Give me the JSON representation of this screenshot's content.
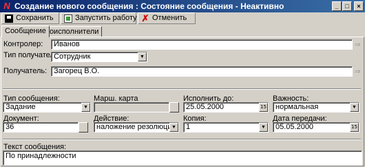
{
  "window": {
    "title": "Создание нового сообщения : Состояние сообщения - Неактивно",
    "app_icon_glyph": "N",
    "controls": {
      "minimize": "_",
      "maximize": "□",
      "close": "×"
    }
  },
  "toolbar": {
    "save_label": "Сохранить",
    "run_label": "Запустить работу",
    "cancel_label": "Отменить",
    "cancel_glyph": "✗"
  },
  "tabs": [
    {
      "label": "Сообщение",
      "active": true
    },
    {
      "label": "Соисполнители",
      "active": false
    }
  ],
  "form": {
    "controller": {
      "label": "Контролер:",
      "value": "Иванов"
    },
    "recipient_type": {
      "label": "Тип получателя:",
      "value": "Сотрудник"
    },
    "recipient": {
      "label": "Получатель:",
      "value": "Загорец В.О."
    },
    "message_type": {
      "label": "Тип сообщения:",
      "value": "Задание"
    },
    "route_card": {
      "label": "Марш. карта",
      "value": ""
    },
    "due_date": {
      "label": "Исполнить до:",
      "value": "25.05.2000"
    },
    "importance": {
      "label": "Важность:",
      "value": "нормальная"
    },
    "document": {
      "label": "Документ:",
      "value": "36"
    },
    "action": {
      "label": "Действие:",
      "value": "наложение резолюции"
    },
    "copy": {
      "label": "Копия:",
      "value": "1"
    },
    "transfer_date": {
      "label": "Дата передачи:",
      "value": "05.05.2000"
    },
    "message_text": {
      "label": "Текст сообщения:",
      "value": "По принадлежности"
    }
  },
  "icons": {
    "dropdown": "▼",
    "calendar": "15",
    "lookup": "⇒"
  },
  "colors": {
    "titlebar_start": "#0a246a",
    "titlebar_end": "#3a6ea5",
    "face": "#d4d0c8",
    "cancel_icon": "#d00000"
  }
}
